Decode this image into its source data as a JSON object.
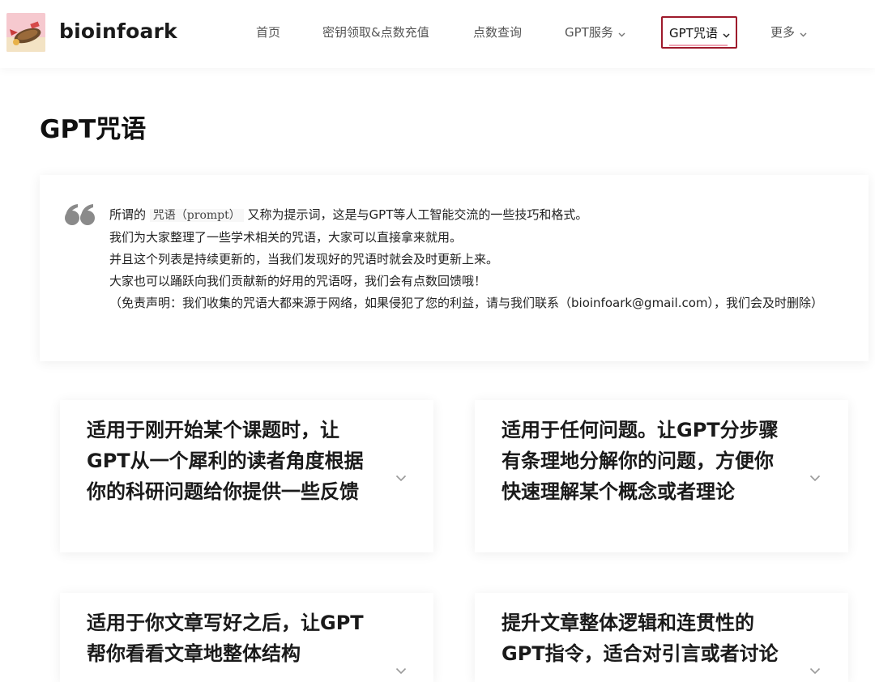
{
  "brand": {
    "name": "bioinfoark"
  },
  "nav": {
    "items": [
      {
        "label": "首页"
      },
      {
        "label": "密钥领取&点数充值"
      },
      {
        "label": "点数查询"
      },
      {
        "label": "GPT服务"
      },
      {
        "label": "GPT咒语"
      },
      {
        "label": "更多"
      }
    ],
    "active_index": 4
  },
  "page": {
    "title": "GPT咒语"
  },
  "intro": {
    "line1_prefix": "所谓的",
    "line1_code": "咒语（prompt）",
    "line1_suffix": "又称为提示词，这是与GPT等人工智能交流的一些技巧和格式。",
    "line2": "我们为大家整理了一些学术相关的咒语，大家可以直接拿来就用。",
    "line3": "并且这个列表是持续更新的，当我们发现好的咒语时就会及时更新上来。",
    "line4": "大家也可以踊跃向我们贡献新的好用的咒语呀，我们会有点数回馈哦！",
    "line5": "（免责声明：我们收集的咒语大都来源于网络，如果侵犯了您的利益，请与我们联系（bioinfoark@gmail.com），我们会及时删除）"
  },
  "cards": [
    {
      "title": "适用于刚开始某个课题时，让GPT从一个犀利的读者角度根据你的科研问题给你提供一些反馈"
    },
    {
      "title": "适用于任何问题。让GPT分步骤有条理地分解你的问题，方便你快速理解某个概念或者理论"
    },
    {
      "title": "适用于你文章写好之后，让GPT帮你看看文章地整体结构"
    },
    {
      "title": "提升文章整体逻辑和连贯性的GPT指令，适合对引言或者讨论"
    }
  ],
  "colors": {
    "active_border": "#9e1a2c",
    "active_underline": "#f1a3b3",
    "quote_mark": "#8a8a8a"
  }
}
